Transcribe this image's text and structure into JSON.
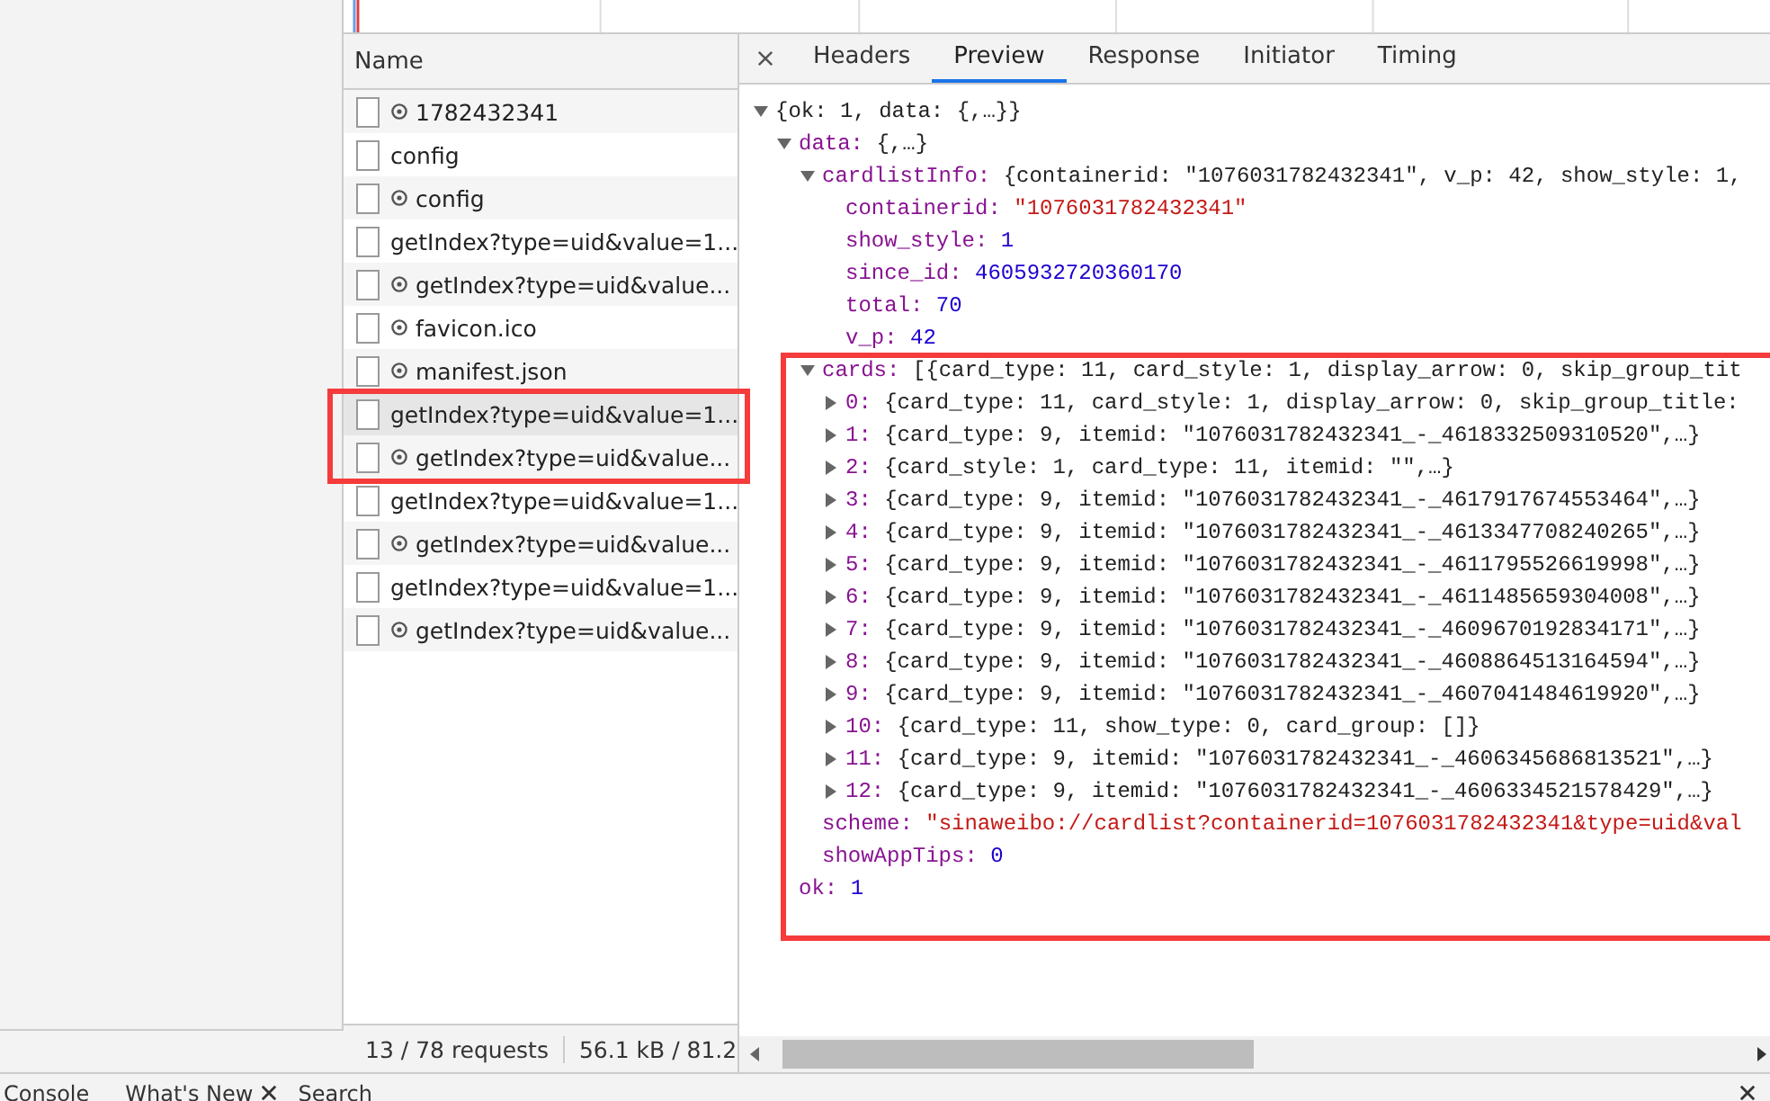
{
  "name_column": {
    "header": "Name"
  },
  "requests": [
    {
      "name": "1782432341",
      "gear": true,
      "selected": false
    },
    {
      "name": "config",
      "gear": false,
      "selected": false
    },
    {
      "name": "config",
      "gear": true,
      "selected": false
    },
    {
      "name": "getIndex?type=uid&value=1...",
      "gear": false,
      "selected": false
    },
    {
      "name": "getIndex?type=uid&value...",
      "gear": true,
      "selected": false
    },
    {
      "name": "favicon.ico",
      "gear": true,
      "selected": false
    },
    {
      "name": "manifest.json",
      "gear": true,
      "selected": false
    },
    {
      "name": "getIndex?type=uid&value=1...",
      "gear": false,
      "selected": true
    },
    {
      "name": "getIndex?type=uid&value...",
      "gear": true,
      "selected": false
    },
    {
      "name": "getIndex?type=uid&value=1...",
      "gear": false,
      "selected": false
    },
    {
      "name": "getIndex?type=uid&value...",
      "gear": true,
      "selected": false
    },
    {
      "name": "getIndex?type=uid&value=1...",
      "gear": false,
      "selected": false
    },
    {
      "name": "getIndex?type=uid&value...",
      "gear": true,
      "selected": false
    }
  ],
  "status_bar": [
    "13 / 78 requests",
    "56.1 kB / 81.2"
  ],
  "detail_tabs": [
    {
      "label": "Headers",
      "selected": false
    },
    {
      "label": "Preview",
      "selected": true
    },
    {
      "label": "Response",
      "selected": false
    },
    {
      "label": "Initiator",
      "selected": false
    },
    {
      "label": "Timing",
      "selected": false
    }
  ],
  "preview_tree": [
    {
      "kind": "object",
      "summary": "{ok: 1, data: {,…}}",
      "expanded": true,
      "children": [
        {
          "kind": "object",
          "key": "data:",
          "summary": "{,…}",
          "expanded": true,
          "children": [
            {
              "kind": "object",
              "key": "cardlistInfo:",
              "summary": "{containerid: \"1076031782432341\", v_p: 42, show_style: 1,",
              "expanded": true,
              "children": [
                {
                  "kind": "string",
                  "key": "containerid:",
                  "value": "\"1076031782432341\""
                },
                {
                  "kind": "number",
                  "key": "show_style:",
                  "value": "1"
                },
                {
                  "kind": "number",
                  "key": "since_id:",
                  "value": "4605932720360170"
                },
                {
                  "kind": "number",
                  "key": "total:",
                  "value": "70"
                },
                {
                  "kind": "number",
                  "key": "v_p:",
                  "value": "42"
                }
              ]
            },
            {
              "kind": "object",
              "key": "cards:",
              "summary": "[{card_type: 11, card_style: 1, display_arrow: 0, skip_group_tit",
              "expanded": true,
              "children": [
                {
                  "kind": "object",
                  "key": "0:",
                  "summary": "{card_type: 11, card_style: 1, display_arrow: 0, skip_group_title:",
                  "expanded": false
                },
                {
                  "kind": "object",
                  "key": "1:",
                  "summary": "{card_type: 9, itemid: \"1076031782432341_-_4618332509310520\",…}",
                  "expanded": false
                },
                {
                  "kind": "object",
                  "key": "2:",
                  "summary": "{card_style: 1, card_type: 11, itemid: \"\",…}",
                  "expanded": false
                },
                {
                  "kind": "object",
                  "key": "3:",
                  "summary": "{card_type: 9, itemid: \"1076031782432341_-_4617917674553464\",…}",
                  "expanded": false
                },
                {
                  "kind": "object",
                  "key": "4:",
                  "summary": "{card_type: 9, itemid: \"1076031782432341_-_4613347708240265\",…}",
                  "expanded": false
                },
                {
                  "kind": "object",
                  "key": "5:",
                  "summary": "{card_type: 9, itemid: \"1076031782432341_-_4611795526619998\",…}",
                  "expanded": false
                },
                {
                  "kind": "object",
                  "key": "6:",
                  "summary": "{card_type: 9, itemid: \"1076031782432341_-_4611485659304008\",…}",
                  "expanded": false
                },
                {
                  "kind": "object",
                  "key": "7:",
                  "summary": "{card_type: 9, itemid: \"1076031782432341_-_4609670192834171\",…}",
                  "expanded": false
                },
                {
                  "kind": "object",
                  "key": "8:",
                  "summary": "{card_type: 9, itemid: \"1076031782432341_-_4608864513164594\",…}",
                  "expanded": false
                },
                {
                  "kind": "object",
                  "key": "9:",
                  "summary": "{card_type: 9, itemid: \"1076031782432341_-_4607041484619920\",…}",
                  "expanded": false
                },
                {
                  "kind": "object",
                  "key": "10:",
                  "summary": "{card_type: 11, show_type: 0, card_group: []}",
                  "expanded": false
                },
                {
                  "kind": "object",
                  "key": "11:",
                  "summary": "{card_type: 9, itemid: \"1076031782432341_-_4606345686813521\",…}",
                  "expanded": false
                },
                {
                  "kind": "object",
                  "key": "12:",
                  "summary": "{card_type: 9, itemid: \"1076031782432341_-_4606334521578429\",…}",
                  "expanded": false
                }
              ]
            },
            {
              "kind": "string",
              "key": "scheme:",
              "value": "\"sinaweibo://cardlist?containerid=1076031782432341&type=uid&val"
            },
            {
              "kind": "number",
              "key": "showAppTips:",
              "value": "0"
            }
          ]
        },
        {
          "kind": "number",
          "key": "ok:",
          "value": "1"
        }
      ]
    }
  ],
  "drawer_tabs": [
    {
      "label": "Console",
      "closable": false
    },
    {
      "label": "What's New",
      "closable": true
    },
    {
      "label": "Search",
      "closable": false
    }
  ]
}
